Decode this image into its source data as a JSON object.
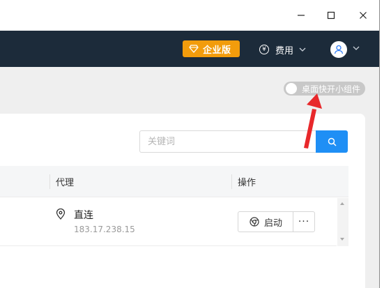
{
  "window": {
    "controls": {
      "minimize_icon": "minimize-icon",
      "maximize_icon": "maximize-icon",
      "close_icon": "close-icon"
    }
  },
  "topnav": {
    "background": "#1c2b3a",
    "enterprise": {
      "label": "企业版",
      "icon": "diamond-icon",
      "color": "#f29c0c"
    },
    "fee": {
      "symbol": "¥",
      "label": "费用",
      "icon": "chevron-down-icon"
    },
    "user": {
      "icon": "user-icon"
    }
  },
  "toggle": {
    "label": "桌面快开小组件",
    "on": false
  },
  "search": {
    "placeholder": "关键词",
    "value": "",
    "button_icon": "search-icon",
    "button_color": "#1f8ff5"
  },
  "table": {
    "columns": [
      "代理",
      "操作"
    ],
    "rows": [
      {
        "proxy": "直连",
        "ip": "183.17.238.15",
        "action": "启动",
        "more": "···"
      }
    ]
  },
  "annotation": {
    "arrow_color": "#e8282b"
  }
}
